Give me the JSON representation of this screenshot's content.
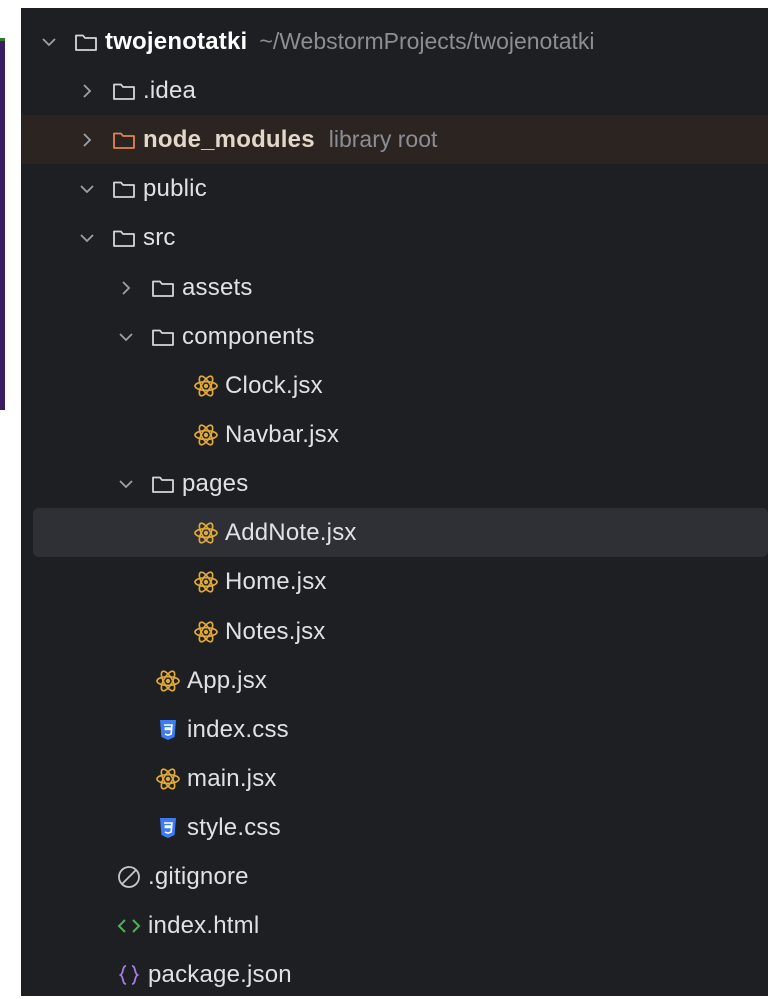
{
  "colors": {
    "panel_bg": "#1e1f22",
    "selected_bg": "#2e3036",
    "excluded_bg": "#2b2420",
    "react_icon": "#e0a93a",
    "css_icon": "#3d7bf0",
    "excluded_folder": "#e0845a",
    "html_icon": "#4fae5b",
    "json_icon": "#a77ce6"
  },
  "tree": {
    "root": {
      "label": "twojenotatki",
      "path": "~/WebstormProjects/twojenotatki",
      "icon": "folder-icon",
      "expanded": true
    },
    "items": [
      {
        "label": ".idea",
        "icon": "folder-icon",
        "expanded": false
      },
      {
        "label": "node_modules",
        "hint": "library root",
        "icon": "excluded-folder-icon",
        "expanded": false
      },
      {
        "label": "public",
        "icon": "folder-icon",
        "expanded": true
      },
      {
        "label": "src",
        "icon": "folder-icon",
        "expanded": true
      },
      {
        "label": "assets",
        "icon": "folder-icon",
        "expanded": false
      },
      {
        "label": "components",
        "icon": "folder-icon",
        "expanded": true
      },
      {
        "label": "Clock.jsx",
        "icon": "react-icon"
      },
      {
        "label": "Navbar.jsx",
        "icon": "react-icon"
      },
      {
        "label": "pages",
        "icon": "folder-icon",
        "expanded": true
      },
      {
        "label": "AddNote.jsx",
        "icon": "react-icon",
        "selected": true
      },
      {
        "label": "Home.jsx",
        "icon": "react-icon"
      },
      {
        "label": "Notes.jsx",
        "icon": "react-icon"
      },
      {
        "label": "App.jsx",
        "icon": "react-icon"
      },
      {
        "label": "index.css",
        "icon": "css-icon"
      },
      {
        "label": "main.jsx",
        "icon": "react-icon"
      },
      {
        "label": "style.css",
        "icon": "css-icon"
      },
      {
        "label": ".gitignore",
        "icon": "ignore-icon"
      },
      {
        "label": "index.html",
        "icon": "html-icon"
      },
      {
        "label": "package.json",
        "icon": "json-icon"
      }
    ]
  }
}
